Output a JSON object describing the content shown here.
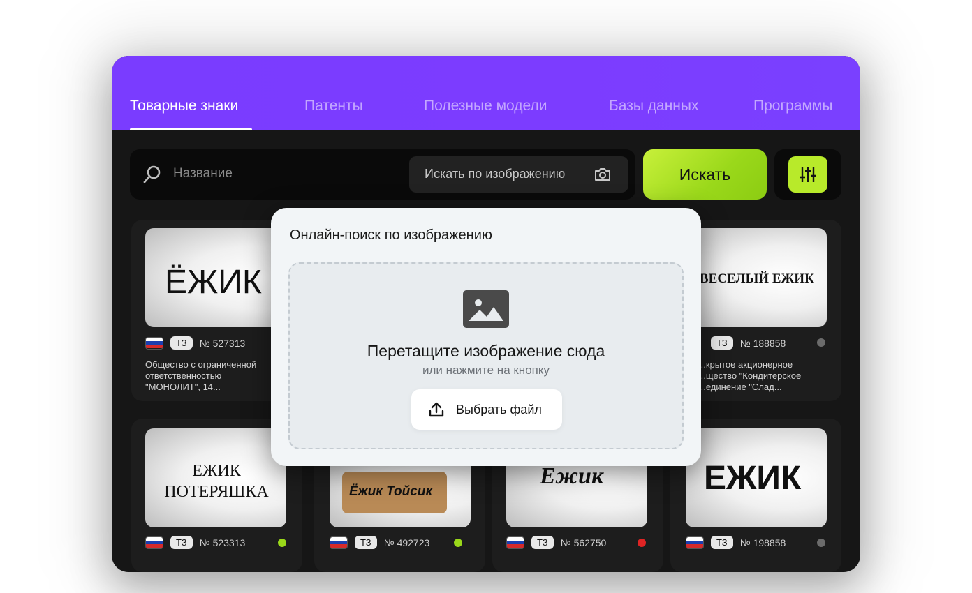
{
  "tabs": [
    {
      "label": "Товарные знаки",
      "active": true
    },
    {
      "label": "Патенты"
    },
    {
      "label": "Полезные модели"
    },
    {
      "label": "Базы данных"
    },
    {
      "label": "Программы"
    }
  ],
  "search": {
    "placeholder": "Название",
    "image_search_label": "Искать по изображению",
    "button_label": "Искать"
  },
  "cards": [
    {
      "logo_text": "ЁЖИК",
      "type": "ТЗ",
      "number": "№ 527313",
      "owner": "Общество с ограниченной ответственностью \"МОНОЛИТ\", 14..."
    },
    {
      "logo_text": "ВЕСЕЛЫЙ ЕЖИК",
      "type": "ТЗ",
      "number": "№ 188858",
      "owner": "...крытое акционерное ...щество \"Кондитерское ...единение \"Слад...",
      "status_color": "#6b6b6b"
    },
    {
      "logo_text": "ЕЖИК ПОТЕРЯШКА",
      "type": "ТЗ",
      "number": "№ 523313",
      "status_color": "#9ad81a"
    },
    {
      "logo_text": "Ёжик Тойсик",
      "type": "ТЗ",
      "number": "№ 492723",
      "status_color": "#9ad81a"
    },
    {
      "logo_text": "Ежик",
      "type": "ТЗ",
      "number": "№ 562750",
      "status_color": "#e02424"
    },
    {
      "logo_text": "ЕЖИК",
      "type": "ТЗ",
      "number": "№ 198858",
      "status_color": "#6b6b6b"
    }
  ],
  "modal": {
    "title": "Онлайн-поиск по изображению",
    "drop_title": "Перетащите изображение сюда",
    "drop_subtitle": "или нажмите на кнопку",
    "file_button_label": "Выбрать файл"
  },
  "colors": {
    "accent_purple": "#7b3cff",
    "accent_green": "#b8ea2a"
  }
}
